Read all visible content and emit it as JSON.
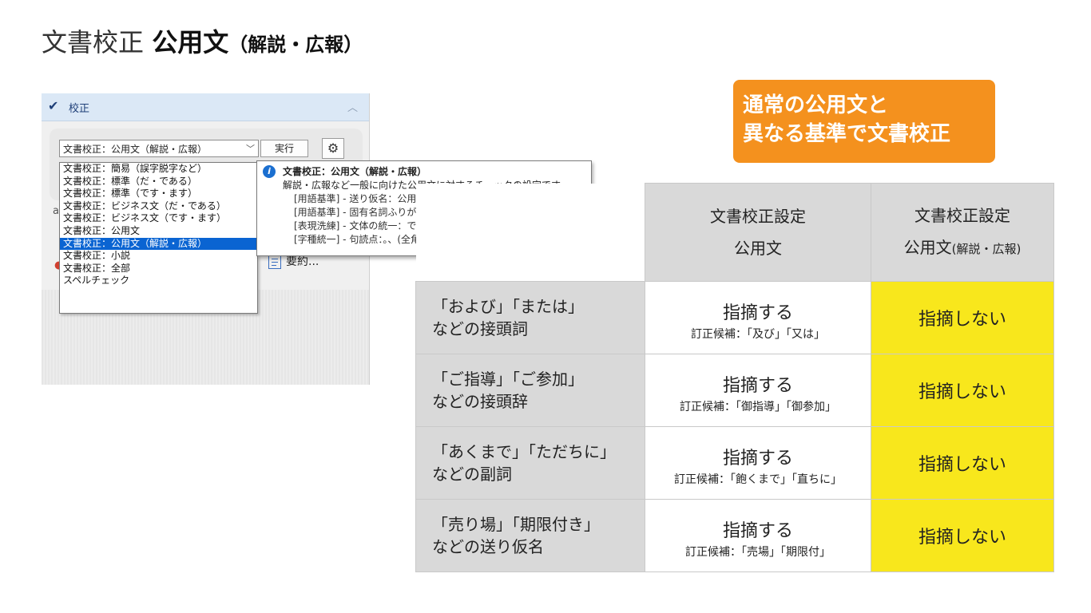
{
  "title": {
    "main": "文書校正",
    "bold": "公用文",
    "paren": "（解説・広報）"
  },
  "panel": {
    "header_label": "校正",
    "combo_value": "文書校正：公用文（解説・広報）",
    "run_label": "実行",
    "side_doc_label": "要約...",
    "dropdown_options": [
      "文書校正：簡易（誤字脱字など）",
      "文書校正：標準（だ・である）",
      "文書校正：標準（です・ます）",
      "文書校正：ビジネス文（だ・である）",
      "文書校正：ビジネス文（です・ます）",
      "文書校正：公用文",
      "文書校正：公用文（解説・広報）",
      "文書校正：小説",
      "文書校正：全部",
      "スペルチェック"
    ],
    "selected_index": 6,
    "tooltip": {
      "title": "文書校正：公用文（解説・広報）",
      "description": "解説・広報など一般に向けた公用文に対するチェックの設定です。",
      "lines": [
        "[用語基準] - 送り仮名：公用文(解説・広報)",
        "[用語基準] - 固有名詞ふりがな付け：しない",
        "[表現洗練] - 文体の統一：です・ます",
        "[字種統一] - 句読点：。、(全角で統一)"
      ]
    }
  },
  "callout": {
    "line1": "通常の公用文と",
    "line2": "異なる基準で文書校正"
  },
  "table": {
    "headers": [
      {
        "line1": "文書校正設定",
        "line2": "公用文",
        "small": ""
      },
      {
        "line1": "文書校正設定",
        "line2": "公用文",
        "small": "(解説・広報)"
      }
    ],
    "rows": [
      {
        "label1": "「および」「または」",
        "label2": "などの接頭詞",
        "mid": "指摘する",
        "sub": "訂正候補：「及び」「又は」",
        "right": "指摘しない"
      },
      {
        "label1": "「ご指導」「ご参加」",
        "label2": "などの接頭辞",
        "mid": "指摘する",
        "sub": "訂正候補：「御指導」「御参加」",
        "right": "指摘しない"
      },
      {
        "label1": "「あくまで」「ただちに」",
        "label2": "などの副詞",
        "mid": "指摘する",
        "sub": "訂正候補：「飽くまで」「直ちに」",
        "right": "指摘しない"
      },
      {
        "label1": "「売り場」「期限付き」",
        "label2": "などの送り仮名",
        "mid": "指摘する",
        "sub": "訂正候補：「売場」「期限付」",
        "right": "指摘しない"
      }
    ]
  }
}
